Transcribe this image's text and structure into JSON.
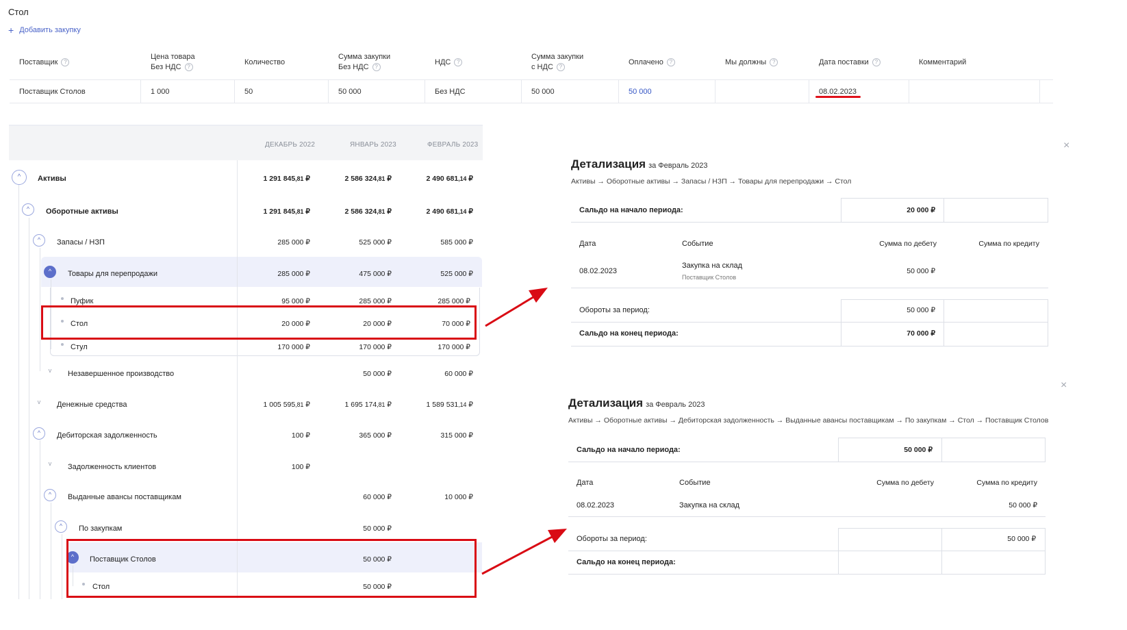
{
  "purchase": {
    "title": "Стол",
    "add_label": "Добавить закупку",
    "headers": [
      {
        "line1": "Поставщик",
        "line2": "",
        "help": true
      },
      {
        "line1": "Цена товара",
        "line2": "Без НДС",
        "help": true
      },
      {
        "line1": "Количество",
        "line2": "",
        "help": false
      },
      {
        "line1": "Сумма закупки",
        "line2": "Без НДС",
        "help": true
      },
      {
        "line1": "НДС",
        "line2": "",
        "help": true
      },
      {
        "line1": "Сумма закупки",
        "line2": "с НДС",
        "help": true
      },
      {
        "line1": "Оплачено",
        "line2": "",
        "help": true
      },
      {
        "line1": "Мы должны",
        "line2": "",
        "help": true
      },
      {
        "line1": "Дата поставки",
        "line2": "",
        "help": true
      },
      {
        "line1": "Комментарий",
        "line2": "",
        "help": false
      }
    ],
    "row": [
      "Поставщик Столов",
      "1 000",
      "50",
      "50 000",
      "Без НДС",
      "50 000",
      "50 000",
      "",
      "08.02.2023",
      ""
    ],
    "paid_link_color": "#3455c4"
  },
  "tree": {
    "months": [
      "ДЕКАБРЬ 2022",
      "ЯНВАРЬ 2023",
      "ФЕВРАЛЬ 2023"
    ],
    "rows": [
      {
        "label": "Активы",
        "bold": true,
        "values": [
          [
            "1 291 845",
            ",81",
            " ₽"
          ],
          [
            "2 586 324",
            ",81",
            " ₽"
          ],
          [
            "2 490 681",
            ",14",
            " ₽"
          ]
        ]
      },
      {
        "label": "Оборотные активы",
        "bold": true,
        "values": [
          [
            "1 291 845",
            ",81",
            " ₽"
          ],
          [
            "2 586 324",
            ",81",
            " ₽"
          ],
          [
            "2 490 681",
            ",14",
            " ₽"
          ]
        ]
      },
      {
        "label": "Запасы / НЗП",
        "bold": false,
        "values": [
          [
            "285 000",
            "",
            " ₽"
          ],
          [
            "525 000",
            "",
            " ₽"
          ],
          [
            "585 000",
            "",
            " ₽"
          ]
        ]
      },
      {
        "label": "Товары для перепродажи",
        "bold": false,
        "values": [
          [
            "285 000",
            "",
            " ₽"
          ],
          [
            "475 000",
            "",
            " ₽"
          ],
          [
            "525 000",
            "",
            " ₽"
          ]
        ]
      },
      {
        "label": "Пуфик",
        "bold": false,
        "values": [
          [
            "95 000",
            "",
            " ₽"
          ],
          [
            "285 000",
            "",
            " ₽"
          ],
          [
            "285 000",
            "",
            " ₽"
          ]
        ]
      },
      {
        "label": "Стол",
        "bold": false,
        "values": [
          [
            "20 000",
            "",
            " ₽"
          ],
          [
            "20 000",
            "",
            " ₽"
          ],
          [
            "70 000",
            "",
            " ₽"
          ]
        ]
      },
      {
        "label": "Стул",
        "bold": false,
        "values": [
          [
            "170 000",
            "",
            " ₽"
          ],
          [
            "170 000",
            "",
            " ₽"
          ],
          [
            "170 000",
            "",
            " ₽"
          ]
        ]
      },
      {
        "label": "Незавершенное производство",
        "bold": false,
        "values": [
          [
            "",
            "",
            ""
          ],
          [
            "50 000",
            "",
            " ₽"
          ],
          [
            "60 000",
            "",
            " ₽"
          ]
        ]
      },
      {
        "label": "Денежные средства",
        "bold": false,
        "values": [
          [
            "1 005 595",
            ",81",
            " ₽"
          ],
          [
            "1 695 174",
            ",81",
            " ₽"
          ],
          [
            "1 589 531",
            ",14",
            " ₽"
          ]
        ]
      },
      {
        "label": "Дебиторская задолженность",
        "bold": false,
        "values": [
          [
            "100",
            "",
            " ₽"
          ],
          [
            "365 000",
            "",
            " ₽"
          ],
          [
            "315 000",
            "",
            " ₽"
          ]
        ]
      },
      {
        "label": "Задолженность клиентов",
        "bold": false,
        "values": [
          [
            "100",
            "",
            " ₽"
          ],
          [
            "",
            "",
            ""
          ],
          [
            "",
            "",
            ""
          ]
        ]
      },
      {
        "label": "Выданные авансы поставщикам",
        "bold": false,
        "values": [
          [
            "",
            "",
            ""
          ],
          [
            "60 000",
            "",
            " ₽"
          ],
          [
            "10 000",
            "",
            " ₽"
          ]
        ]
      },
      {
        "label": "По закупкам",
        "bold": false,
        "values": [
          [
            "",
            "",
            ""
          ],
          [
            "50 000",
            "",
            " ₽"
          ],
          [
            "",
            "",
            ""
          ]
        ]
      },
      {
        "label": "Поставщик Столов",
        "bold": false,
        "values": [
          [
            "",
            "",
            ""
          ],
          [
            "50 000",
            "",
            " ₽"
          ],
          [
            "",
            "",
            ""
          ]
        ]
      },
      {
        "label": "Стол",
        "bold": false,
        "values": [
          [
            "",
            "",
            ""
          ],
          [
            "50 000",
            "",
            " ₽"
          ],
          [
            "",
            "",
            ""
          ]
        ]
      }
    ]
  },
  "detail1": {
    "close": "×",
    "title": "Детализация",
    "period": "за Февраль 2023",
    "path": "Активы → Оборотные активы → Запасы / НЗП → Товары для перепродажи → Стол",
    "opening_label": "Сальдо на начало периода:",
    "opening_debit": "20 000 ₽",
    "opening_credit": "",
    "col_date": "Дата",
    "col_event": "Событие",
    "col_debit": "Сумма по дебету",
    "col_credit": "Сумма по кредиту",
    "entry": {
      "date": "08.02.2023",
      "event": "Закупка на склад",
      "event_sub": "Поставщик Столов",
      "debit": "50 000 ₽",
      "credit": ""
    },
    "turnover_label": "Обороты за период:",
    "turnover_debit": "50 000 ₽",
    "turnover_credit": "",
    "closing_label": "Сальдо на конец периода:",
    "closing_debit": "70 000 ₽",
    "closing_credit": ""
  },
  "detail2": {
    "close": "×",
    "title": "Детализация",
    "period": "за Февраль 2023",
    "path": "Активы → Оборотные активы → Дебиторская задолженность → Выданные авансы поставщикам → По закупкам → Стол → Поставщик Столов",
    "opening_label": "Сальдо на начало периода:",
    "opening_debit": "50 000 ₽",
    "opening_credit": "",
    "col_date": "Дата",
    "col_event": "Событие",
    "col_debit": "Сумма по дебету",
    "col_credit": "Сумма по кредиту",
    "entry": {
      "date": "08.02.2023",
      "event": "Закупка на склад",
      "debit": "",
      "credit": "50 000 ₽"
    },
    "turnover_label": "Обороты за период:",
    "turnover_debit": "",
    "turnover_credit": "50 000 ₽",
    "closing_label": "Сальдо на конец периода:",
    "closing_debit": "",
    "closing_credit": ""
  },
  "colors": {
    "accent": "#5d6fca",
    "highlight": "#d90b14",
    "row_highlight": "#eef0fb"
  }
}
